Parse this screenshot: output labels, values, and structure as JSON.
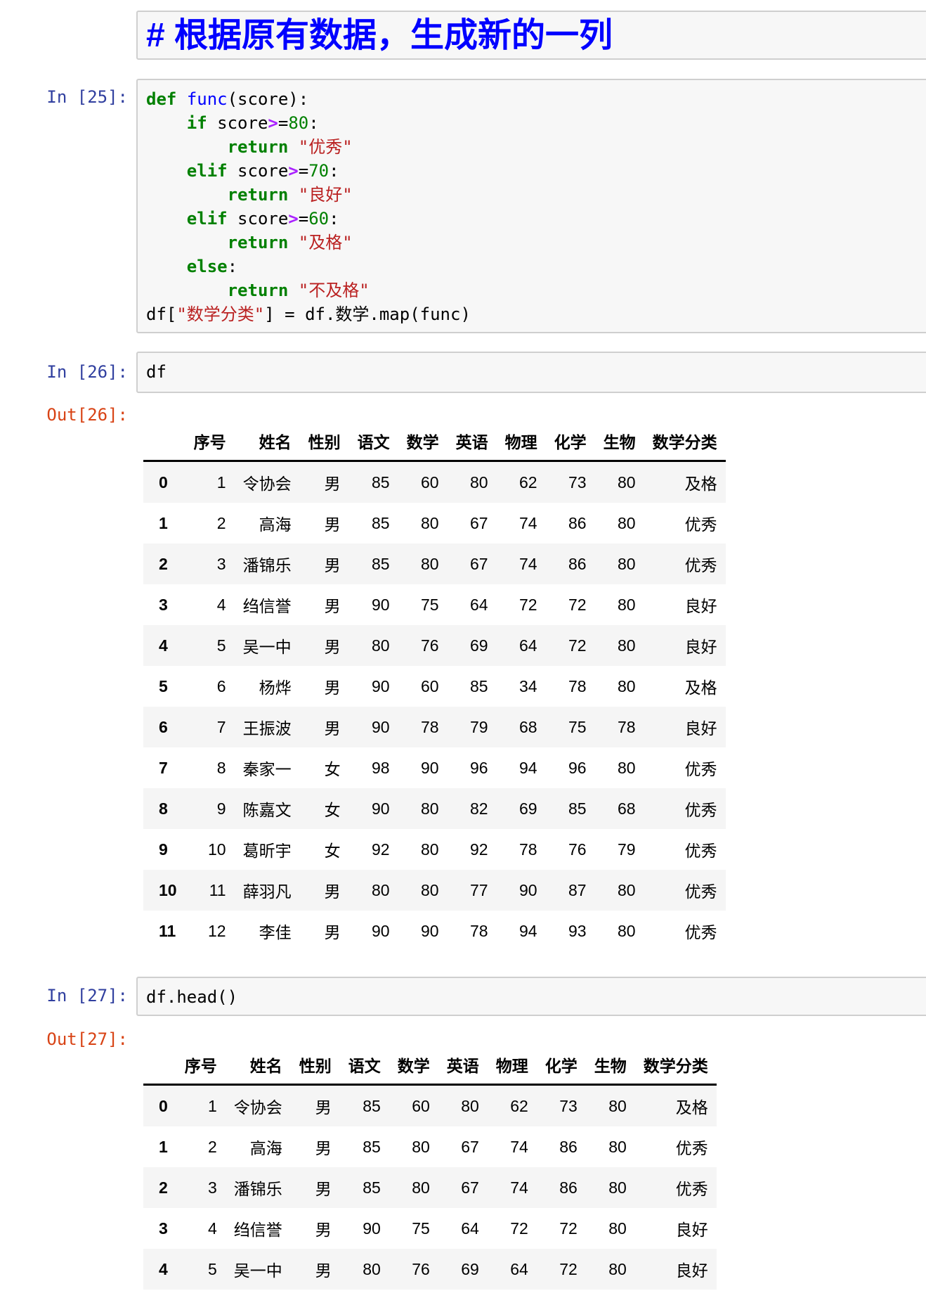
{
  "markdown": {
    "title": "# 根据原有数据，生成新的一列"
  },
  "cells": [
    {
      "prompt": "In [25]:"
    },
    {
      "prompt": "In [26]:",
      "code": "df",
      "out": "Out[26]:"
    },
    {
      "prompt": "In [27]:",
      "code": "df.head()",
      "out": "Out[27]:"
    }
  ],
  "code25": {
    "def": "def",
    "func": "func",
    "sig": "(score):",
    "if": "if",
    "elif": "elif",
    "else": "else",
    "ret": "return",
    "score": " score",
    "ge": ">",
    "eq": "=",
    "colon": ":",
    "n80": "80",
    "n70": "70",
    "n60": "60",
    "s1": "\"优秀\"",
    "s2": "\"良好\"",
    "s3": "\"及格\"",
    "s4": "\"不及格\"",
    "last_a": "df[",
    "last_s": "\"数学分类\"",
    "last_b": "] = df.数学.map(func)"
  },
  "table": {
    "columns": [
      "",
      "序号",
      "姓名",
      "性别",
      "语文",
      "数学",
      "英语",
      "物理",
      "化学",
      "生物",
      "数学分类"
    ],
    "rows": [
      [
        "0",
        "1",
        "令协会",
        "男",
        "85",
        "60",
        "80",
        "62",
        "73",
        "80",
        "及格"
      ],
      [
        "1",
        "2",
        "高海",
        "男",
        "85",
        "80",
        "67",
        "74",
        "86",
        "80",
        "优秀"
      ],
      [
        "2",
        "3",
        "潘锦乐",
        "男",
        "85",
        "80",
        "67",
        "74",
        "86",
        "80",
        "优秀"
      ],
      [
        "3",
        "4",
        "绉信誉",
        "男",
        "90",
        "75",
        "64",
        "72",
        "72",
        "80",
        "良好"
      ],
      [
        "4",
        "5",
        "吴一中",
        "男",
        "80",
        "76",
        "69",
        "64",
        "72",
        "80",
        "良好"
      ],
      [
        "5",
        "6",
        "杨烨",
        "男",
        "90",
        "60",
        "85",
        "34",
        "78",
        "80",
        "及格"
      ],
      [
        "6",
        "7",
        "王振波",
        "男",
        "90",
        "78",
        "79",
        "68",
        "75",
        "78",
        "良好"
      ],
      [
        "7",
        "8",
        "秦家一",
        "女",
        "98",
        "90",
        "96",
        "94",
        "96",
        "80",
        "优秀"
      ],
      [
        "8",
        "9",
        "陈嘉文",
        "女",
        "90",
        "80",
        "82",
        "69",
        "85",
        "68",
        "优秀"
      ],
      [
        "9",
        "10",
        "葛昕宇",
        "女",
        "92",
        "80",
        "92",
        "78",
        "76",
        "79",
        "优秀"
      ],
      [
        "10",
        "11",
        "薛羽凡",
        "男",
        "80",
        "80",
        "77",
        "90",
        "87",
        "80",
        "优秀"
      ],
      [
        "11",
        "12",
        "李佳",
        "男",
        "90",
        "90",
        "78",
        "94",
        "93",
        "80",
        "优秀"
      ]
    ]
  }
}
